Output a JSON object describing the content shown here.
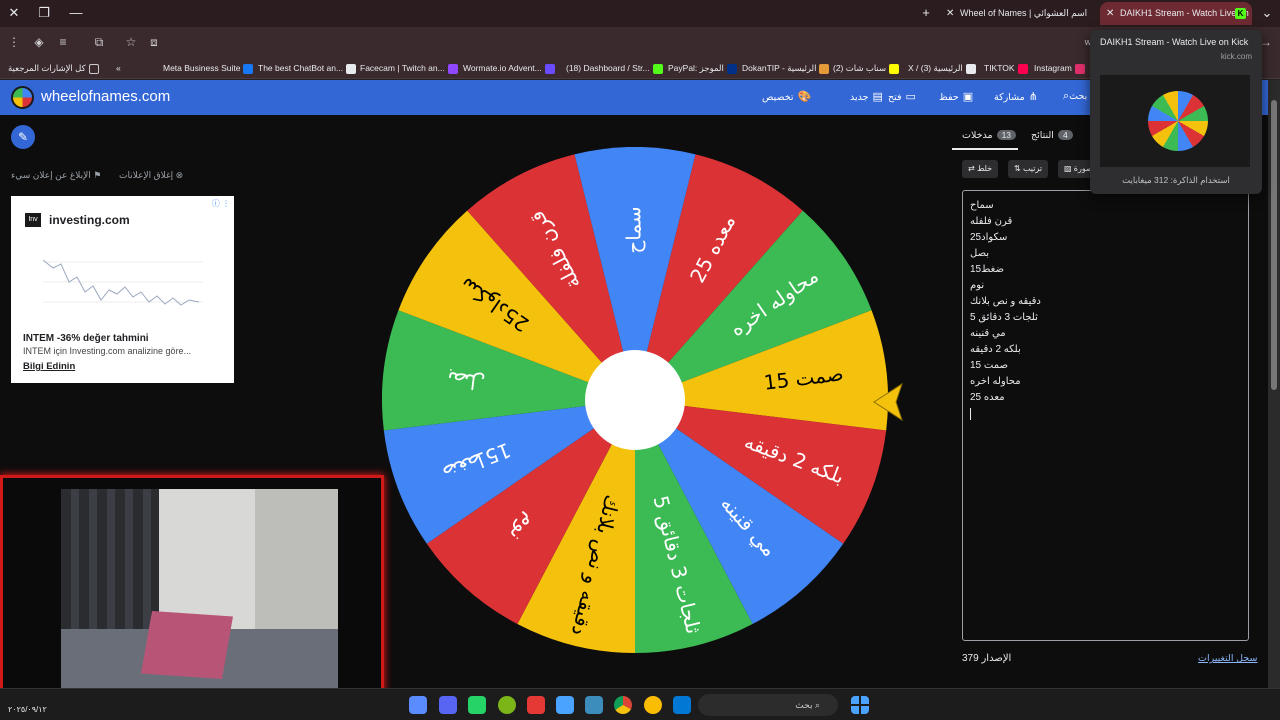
{
  "browser": {
    "tabs": [
      {
        "title": "Wheel of Names | اسم العشوائي",
        "active": false
      },
      {
        "title": "DAIKH1 Stream - Watch Live on Kick",
        "active": true
      }
    ],
    "address_hint": "w",
    "bookmarks": [
      {
        "label": "كل الإشارات المرجعية",
        "color": "#e8eaed"
      },
      {
        "label": "Meta Business Suite",
        "color": "#1877f2"
      },
      {
        "label": "The best ChatBot an...",
        "color": "#e8eaed"
      },
      {
        "label": "Facecam | Twitch an...",
        "color": "#9146ff"
      },
      {
        "label": "Wormate.io Advent...",
        "color": "#6a4cff"
      },
      {
        "label": "(18) Dashboard / Str...",
        "color": "#53fc18"
      },
      {
        "label": "PayPal: الموجز",
        "color": "#003087"
      },
      {
        "label": "DokanTIP - الرئيسية",
        "color": "#e59a3a"
      },
      {
        "label": "(2) سناب شات",
        "color": "#fffc00"
      },
      {
        "label": "X / (3) الرئيسية",
        "color": "#e8eaed"
      },
      {
        "label": "TIKTOK",
        "color": "#ff0050"
      },
      {
        "label": "Instagram",
        "color": "#e1306c"
      }
    ]
  },
  "site": {
    "name": "wheelofnames.com",
    "nav": {
      "customize": "تخصيص",
      "new": "جديد",
      "open": "فتح",
      "save": "حفظ",
      "share": "مشاركة",
      "search": "بحث"
    }
  },
  "ads": {
    "close_label": "إغلاق الإعلانات",
    "report_label": "الإبلاغ عن إعلان سيء",
    "card": {
      "logo": "Inv",
      "brand": "investing.com",
      "title": "INTEM -36% değer tahmini",
      "subtitle": "INTEM için Investing.com analizine göre...",
      "cta": "Bilgi Edinin"
    }
  },
  "wheel": {
    "segments": [
      {
        "label": "سماح",
        "color": "#4285f4"
      },
      {
        "label": "معده 25",
        "color": "#db3236"
      },
      {
        "label": "محاوله اخره",
        "color": "#3cba54"
      },
      {
        "label": "صمت 15",
        "color": "#f4c20d"
      },
      {
        "label": "بلكه 2 دقيقه",
        "color": "#db3236"
      },
      {
        "label": "مي قنينه",
        "color": "#4285f4"
      },
      {
        "label": "ثلجات 3 دقائق 5",
        "color": "#3cba54"
      },
      {
        "label": "دقيقه و نص بلانك",
        "color": "#f4c20d"
      },
      {
        "label": "نوم",
        "color": "#db3236"
      },
      {
        "label": "ضغط15",
        "color": "#4285f4"
      },
      {
        "label": "بصل",
        "color": "#3cba54"
      },
      {
        "label": "سكواد25",
        "color": "#f4c20d"
      },
      {
        "label": "قرن فلفلة",
        "color": "#db3236"
      }
    ]
  },
  "panel": {
    "entries_tab": "مدخلات",
    "entries_count": "13",
    "results_tab": "النتائج",
    "results_count": "4",
    "shuffle": "خلط",
    "sort": "ترتيب",
    "image": "صورة",
    "entries": [
      "سماح",
      "قرن فلفله",
      "سكواد25",
      "بصل",
      "ضغط15",
      "نوم",
      "دقيقه و نص بلانك",
      "ثلجات 3 دقائق 5",
      "مي قنينه",
      "بلكه 2 دقيقه",
      "صمت 15",
      "محاوله اخره",
      "معده 25"
    ],
    "version_label": "الإصدار",
    "version": "379",
    "changelog": "سجل التغييرات"
  },
  "tab_preview": {
    "title": "DAIKH1 Stream - Watch Live on Kick",
    "url": "kick.com",
    "memory": "استخدام الذاكرة: 312 ميغابايت"
  },
  "taskbar": {
    "search": "بحث",
    "clock": "٢٠٢٥/٠٩/١٢"
  }
}
